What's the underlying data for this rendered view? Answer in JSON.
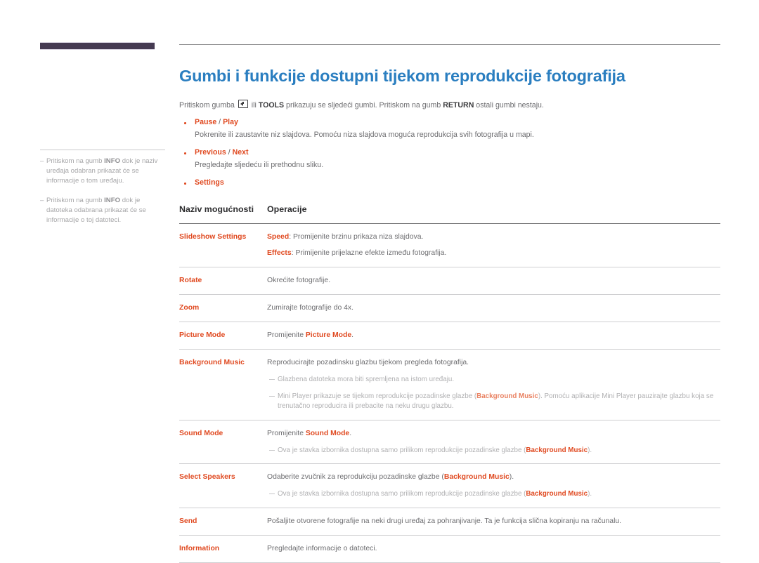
{
  "sidebar": {
    "notes": [
      {
        "dash": "–",
        "text_before": "Pritiskom na gumb ",
        "bold": "INFO",
        "text_after": " dok je naziv uređaja odabran prikazat će se informacije o tom uređaju."
      },
      {
        "dash": "–",
        "text_before": "Pritiskom na gumb ",
        "bold": "INFO",
        "text_after": " dok je datoteka odabrana prikazat će se informacije o toj datoteci."
      }
    ]
  },
  "main": {
    "title": "Gumbi i funkcije dostupni tijekom reprodukcije fotografija",
    "intro": {
      "part1": "Pritiskom gumba ",
      "icon": "enter-key-icon",
      "part2": " ili ",
      "bold1": "TOOLS",
      "part3": " prikazuju se sljedeći gumbi. Pritiskom na gumb ",
      "bold2": "RETURN",
      "part4": " ostali gumbi nestaju."
    },
    "bullets": [
      {
        "head_a": "Pause",
        "slash": " / ",
        "head_b": "Play",
        "body": "Pokrenite ili zaustavite niz slajdova. Pomoću niza slajdova moguća reprodukcija svih fotografija u mapi."
      },
      {
        "head_a": "Previous",
        "slash": " / ",
        "head_b": "Next",
        "body": "Pregledajte sljedeću ili prethodnu sliku."
      },
      {
        "head_a": "Settings",
        "slash": "",
        "head_b": "",
        "body": ""
      }
    ],
    "table": {
      "header": {
        "col1": "Naziv mogućnosti",
        "col2": "Operacije"
      },
      "rows": [
        {
          "name": "Slideshow Settings",
          "lines": [
            {
              "lead": "Speed",
              "sep": ": ",
              "text": "Promijenite brzinu prikaza niza slajdova."
            },
            {
              "lead": "Effects",
              "sep": ": ",
              "text": "Primijenite prijelazne efekte između fotografija."
            }
          ],
          "notes": []
        },
        {
          "name": "Rotate",
          "lines": [
            {
              "lead": "",
              "sep": "",
              "text": "Okrećite fotografije."
            }
          ],
          "notes": []
        },
        {
          "name": "Zoom",
          "lines": [
            {
              "lead": "",
              "sep": "",
              "text": "Zumirajte fotografije do 4x."
            }
          ],
          "notes": []
        },
        {
          "name": "Picture Mode",
          "lines": [
            {
              "lead": "",
              "sep": "",
              "text": "Promijenite ",
              "tail_bold": "Picture Mode",
              "tail": "."
            }
          ],
          "notes": []
        },
        {
          "name": "Background Music",
          "lines": [
            {
              "lead": "",
              "sep": "",
              "text": "Reproducirajte pozadinsku glazbu tijekom pregleda fotografija."
            }
          ],
          "notes": [
            {
              "text": "Glazbena datoteka mora biti spremljena na istom uređaju."
            },
            {
              "text_a": "Mini Player prikazuje se tijekom reprodukcije pozadinske glazbe (",
              "bold": "Background Music",
              "text_b": "). Pomoću aplikacije Mini Player pauzirajte glazbu koja se trenutačno reproducira ili prebacite na neku drugu glazbu."
            }
          ]
        },
        {
          "name": "Sound Mode",
          "lines": [
            {
              "lead": "",
              "sep": "",
              "text": "Promijenite ",
              "tail_bold": "Sound Mode",
              "tail": "."
            }
          ],
          "notes": [
            {
              "text_a": "Ova je stavka izbornika dostupna samo prilikom reprodukcije pozadinske glazbe (",
              "bold": "Background Music",
              "text_b": ")."
            }
          ]
        },
        {
          "name": "Select Speakers",
          "lines": [
            {
              "lead": "",
              "sep": "",
              "text": "Odaberite zvučnik za reprodukciju pozadinske glazbe (",
              "tail_bold": "Background Music",
              "tail": ")."
            }
          ],
          "notes": [
            {
              "text_a": "Ova je stavka izbornika dostupna samo prilikom reprodukcije pozadinske glazbe (",
              "bold": "Background Music",
              "text_b": ")."
            }
          ]
        },
        {
          "name": "Send",
          "lines": [
            {
              "lead": "",
              "sep": "",
              "text": "Pošaljite otvorene fotografije na neki drugi uređaj za pohranjivanje. Ta je funkcija slična kopiranju na računalu."
            }
          ],
          "notes": []
        },
        {
          "name": "Information",
          "lines": [
            {
              "lead": "",
              "sep": "",
              "text": "Pregledajte informacije o datoteci."
            }
          ],
          "notes": []
        }
      ]
    }
  },
  "colors": {
    "title_blue": "#2a7ec0",
    "accent_orange": "#e04a21",
    "body_gray": "#6d6d70",
    "rail_bar": "#453a52"
  }
}
